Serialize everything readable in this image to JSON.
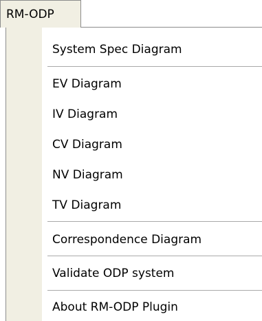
{
  "menubar": {
    "title": "RM-ODP"
  },
  "menu": {
    "items": [
      {
        "label": "System Spec Diagram"
      },
      {
        "label": "EV Diagram"
      },
      {
        "label": "IV Diagram"
      },
      {
        "label": "CV Diagram"
      },
      {
        "label": "NV Diagram"
      },
      {
        "label": "TV Diagram"
      },
      {
        "label": "Correspondence Diagram"
      },
      {
        "label": "Validate ODP system"
      },
      {
        "label": "About RM-ODP Plugin"
      }
    ]
  }
}
